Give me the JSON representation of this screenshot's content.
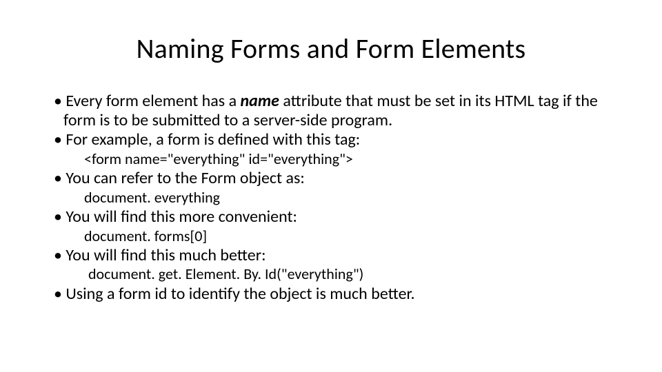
{
  "title": "Naming Forms and Form Elements",
  "bullets": {
    "b1a": "Every form element has a ",
    "b1b": "name",
    "b1c": " attribute that must be set in its HTML tag if the form is to be submitted to a server-side program.",
    "b2": "For example, a form is defined with this tag:",
    "s2": "<form name=\"everything\" id=\"everything\">",
    "b3": "You can refer to the Form object as:",
    "s3": "document. everything",
    "b4": "You will find this more convenient:",
    "s4": "document. forms[0]",
    "b5": "You will find this much better:",
    "s5": "document. get. Element. By. Id(\"everything\")",
    "b6": "Using a form id to identify the object is much better."
  }
}
